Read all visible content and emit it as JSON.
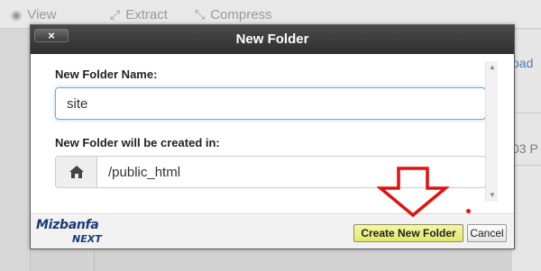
{
  "background": {
    "toolbar": [
      {
        "icon": "eye-icon",
        "label": "View"
      },
      {
        "icon": "extract-icon",
        "label": "Extract"
      },
      {
        "icon": "compress-icon",
        "label": "Compress"
      }
    ],
    "partial_link": "oad",
    "partial_date": "03 P"
  },
  "dialog": {
    "title": "New Folder",
    "close_label": "×",
    "name_label": "New Folder Name:",
    "name_value": "site",
    "location_label": "New Folder will be created in:",
    "location_value": "/public_html",
    "location_icon": "home-icon",
    "create_button": "Create New Folder",
    "cancel_button": "Cancel"
  },
  "watermark": {
    "brand": "Mizbanfa",
    "sub": "NEXT"
  },
  "colors": {
    "header": "#333333",
    "create_button": "#e8ee7a",
    "input_focus": "#66afe9",
    "annotation": "#e11111"
  }
}
